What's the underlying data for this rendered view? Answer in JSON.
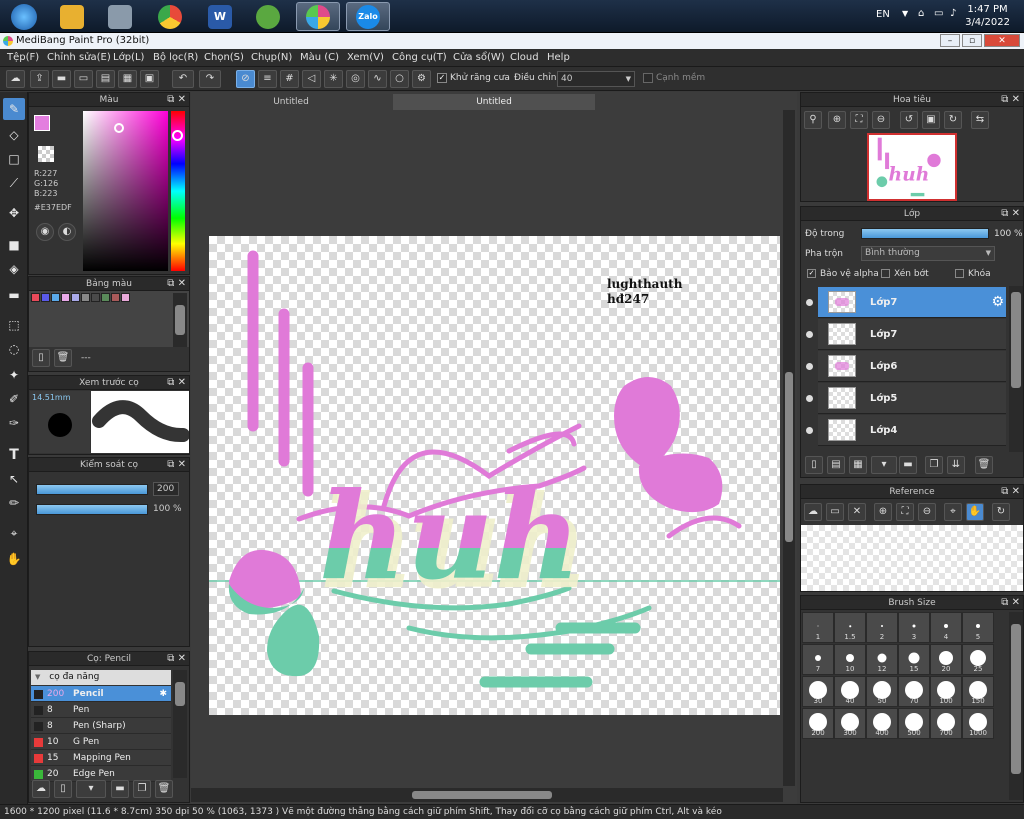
{
  "taskbar": {
    "apps": [
      {
        "name": "start-orb-icon",
        "label": "",
        "color": "#2a78c8"
      },
      {
        "name": "file-explorer-icon",
        "label": "",
        "color": "#e8b030"
      },
      {
        "name": "calculator-icon",
        "label": "",
        "color": "#7a8a9a"
      },
      {
        "name": "chrome-icon",
        "label": "",
        "color": "#4a9a4a"
      },
      {
        "name": "word-icon",
        "label": "W",
        "color": "#2a5aa8"
      },
      {
        "name": "camtasia-icon",
        "label": "",
        "color": "#5aa840"
      },
      {
        "name": "medibang-icon",
        "label": "",
        "color": "#e04a8a"
      },
      {
        "name": "zalo-icon",
        "label": "Zalo",
        "color": "#1a8ae8"
      }
    ],
    "lang": "EN",
    "time": "1:47 PM",
    "date": "3/4/2022"
  },
  "window": {
    "title": "MediBang Paint Pro (32bit)"
  },
  "menu": [
    "Tệp(F)",
    "Chỉnh sửa(E)",
    "Lớp(L)",
    "Bộ lọc(R)",
    "Chọn(S)",
    "Chụp(N)",
    "Màu (C)",
    "Xem(V)",
    "Công cụ(T)",
    "Cửa sổ(W)",
    "Cloud",
    "Help"
  ],
  "toolbar": {
    "antialias_label": "Khử răng cưa",
    "correction_label": "Điều chỉnh",
    "correction_value": "40",
    "soft_edge_label": "Cạnh mềm"
  },
  "color_panel": {
    "title": "Màu",
    "r": "R:227",
    "g": "G:126",
    "b": "B:223",
    "hex": "#E37EDF",
    "current_color": "#e37edf"
  },
  "palette_panel": {
    "title": "Bảng màu",
    "colors": [
      "#e84a5a",
      "#5a5ae8",
      "#5aa8e8",
      "#e8a8e8",
      "#a8a8e8",
      "#888888",
      "#4a4a4a",
      "#5a8a5a",
      "#a85a5a",
      "#e8a8d8"
    ],
    "name_value": "---"
  },
  "preview_panel": {
    "title": "Xem trước cọ",
    "size": "14.51mm"
  },
  "brush_control": {
    "title": "Kiểm soát cọ",
    "size_value": "200",
    "opacity_value": "100 %"
  },
  "brush_panel": {
    "title": "Cọ: Pencil",
    "group": "cọ đa năng",
    "items": [
      {
        "size": "200",
        "name": "Pencil",
        "color": "#222222"
      },
      {
        "size": "8",
        "name": "Pen",
        "color": "#222222"
      },
      {
        "size": "8",
        "name": "Pen (Sharp)",
        "color": "#222222"
      },
      {
        "size": "10",
        "name": "G Pen",
        "color": "#e83a3a"
      },
      {
        "size": "15",
        "name": "Mapping Pen",
        "color": "#e83a3a"
      },
      {
        "size": "20",
        "name": "Edge Pen",
        "color": "#3ab83a"
      }
    ]
  },
  "document_tabs": [
    "Untitled",
    "Untitled"
  ],
  "canvas": {
    "text_line1": "lughthauth",
    "text_line2": "hđ247",
    "art_text": "huh"
  },
  "navigator": {
    "title": "Hoa tiêu"
  },
  "layers_panel": {
    "title": "Lớp",
    "opacity_label": "Độ trong",
    "opacity_value": "100 %",
    "opacity_fraction": 1.0,
    "blend_label": "Pha trộn",
    "blend_value": "Bình thường",
    "protect_alpha": "Bảo vệ alpha",
    "clipping": "Xén bớt",
    "lock": "Khóa",
    "layers": [
      "Lớp7",
      "Lớp7",
      "Lớp6",
      "Lớp5",
      "Lớp4"
    ]
  },
  "reference_panel": {
    "title": "Reference"
  },
  "brush_size_panel": {
    "title": "Brush Size",
    "sizes": [
      "1",
      "1.5",
      "2",
      "3",
      "4",
      "5",
      "7",
      "10",
      "12",
      "15",
      "20",
      "25",
      "30",
      "40",
      "50",
      "70",
      "100",
      "150",
      "200",
      "300",
      "400",
      "500",
      "700",
      "1000"
    ]
  },
  "status": {
    "text": "1600 * 1200 pixel  (11.6 * 8.7cm)  350 dpi  50 %  (1063, 1373 )  Vẽ một đường thẳng bằng cách giữ phím Shift, Thay đổi cỡ cọ bằng cách giữ phím Ctrl, Alt và kéo"
  }
}
